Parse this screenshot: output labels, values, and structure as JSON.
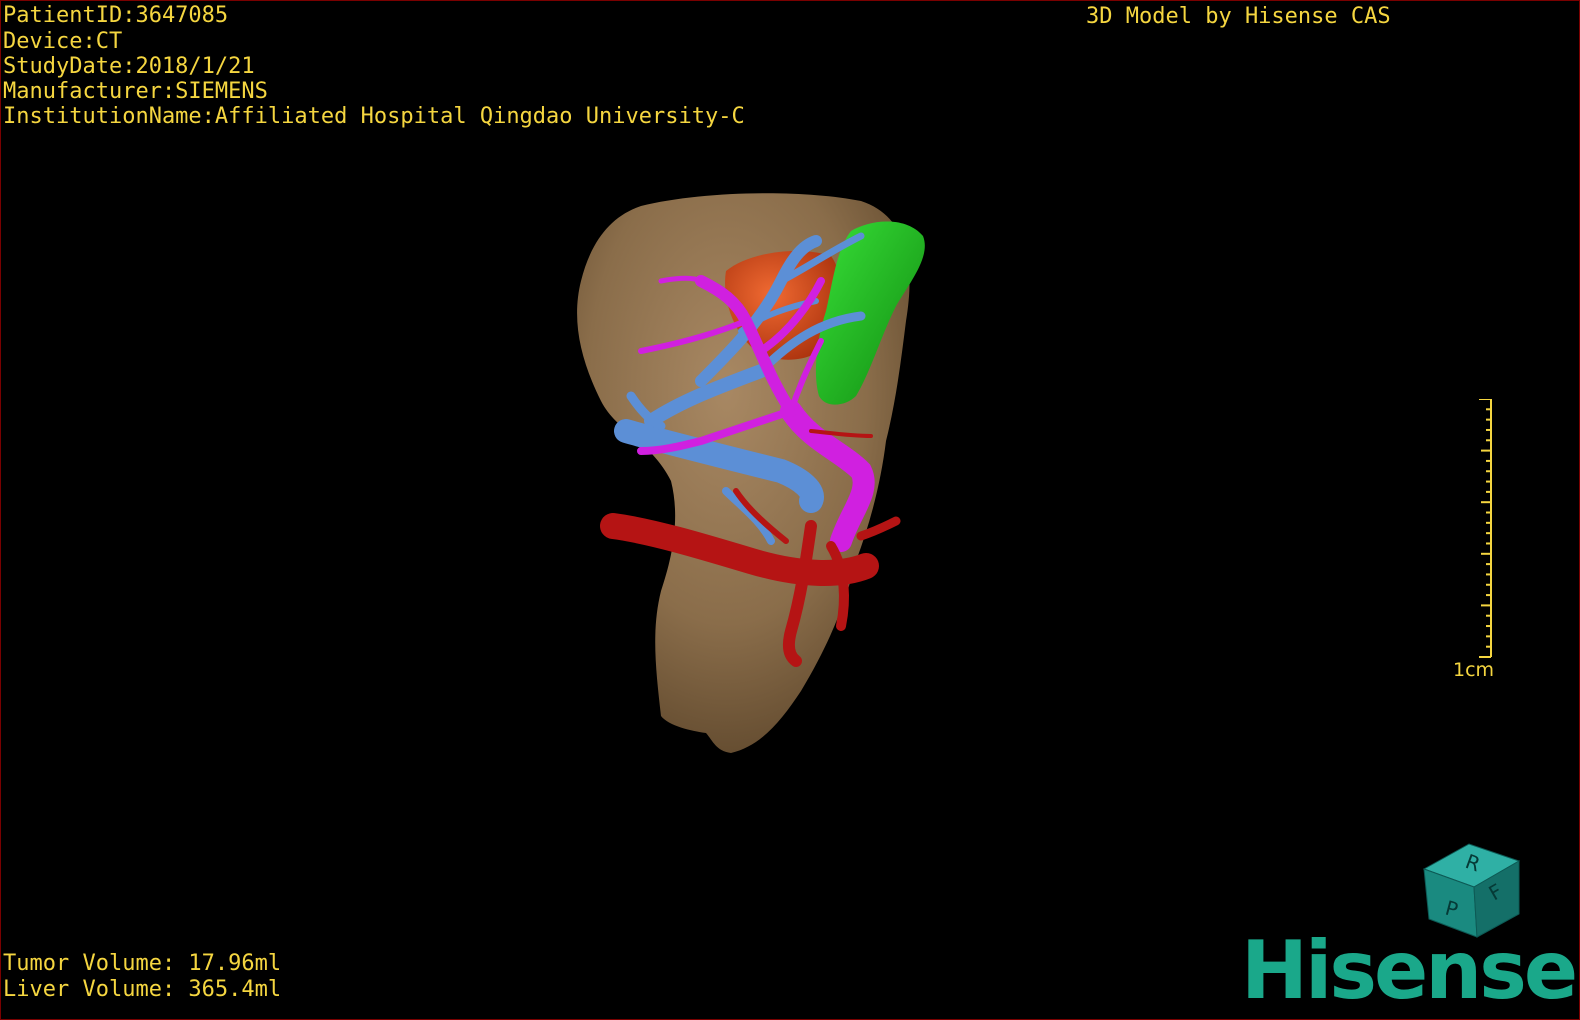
{
  "patient_info": {
    "patient_id": "PatientID:3647085",
    "device": "Device:CT",
    "study_date": "StudyDate:2018/1/21",
    "manufacturer": "Manufacturer:SIEMENS",
    "institution": "InstitutionName:Affiliated Hospital Qingdao University-C"
  },
  "brand_text": "3D Model by Hisense CAS",
  "volumes": {
    "tumor": "Tumor Volume: 17.96ml",
    "liver": "Liver Volume: 365.4ml"
  },
  "scale_bar": {
    "label": "1cm"
  },
  "orientation_cube": {
    "faces": [
      "R",
      "F",
      "P"
    ]
  },
  "logo_text": "Hisense",
  "colors": {
    "overlay_text": "#f5d640",
    "liver": "#8a6d4a",
    "tumor": "#d64a1a",
    "gallbladder": "#1fb81f",
    "portal_vein": "#d020e0",
    "hepatic_vein": "#5c8fd6",
    "artery": "#b51414",
    "logo": "#1aa88a",
    "cube": "#1a8a80",
    "border": "#7a0000"
  }
}
